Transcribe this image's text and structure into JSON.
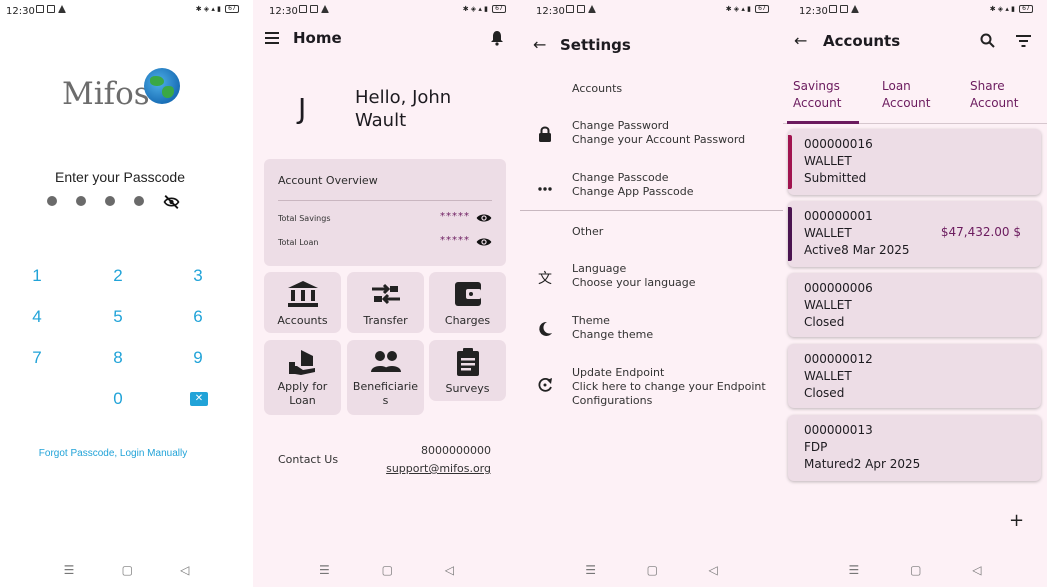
{
  "status": {
    "time": "12:30",
    "battery": "67"
  },
  "passcode_screen": {
    "logo_text": "Mifos",
    "title": "Enter your Passcode",
    "keys": [
      "1",
      "2",
      "3",
      "4",
      "5",
      "6",
      "7",
      "8",
      "9",
      "0"
    ],
    "forgot_link": "Forgot Passcode, Login Manually"
  },
  "home_screen": {
    "title": "Home",
    "avatar_initial": "J",
    "greeting": "Hello, John Wault",
    "overview": {
      "title": "Account Overview",
      "rows": [
        {
          "label": "Total Savings",
          "value": "*****"
        },
        {
          "label": "Total Loan",
          "value": "*****"
        }
      ]
    },
    "tiles": [
      {
        "label": "Accounts",
        "icon": "bank-icon"
      },
      {
        "label": "Transfer",
        "icon": "transfer-icon"
      },
      {
        "label": "Charges",
        "icon": "wallet-icon"
      },
      {
        "label": "Apply for Loan",
        "icon": "hand-coin-icon"
      },
      {
        "label": "Beneficiarie s",
        "icon": "people-icon"
      },
      {
        "label": "Surveys",
        "icon": "clipboard-icon"
      }
    ],
    "contact": {
      "label": "Contact Us",
      "phone": "8000000000",
      "email": "support@mifos.org"
    }
  },
  "settings_screen": {
    "title": "Settings",
    "section_accounts": "Accounts",
    "section_other": "Other",
    "items": [
      {
        "title": "Change Password",
        "subtitle": "Change your Account Password",
        "icon": "lock-icon"
      },
      {
        "title": "Change Passcode",
        "subtitle": "Change App Passcode",
        "icon": "dots-icon"
      },
      {
        "title": "Language",
        "subtitle": "Choose your language",
        "icon": "translate-icon"
      },
      {
        "title": "Theme",
        "subtitle": "Change theme",
        "icon": "moon-icon"
      },
      {
        "title": "Update Endpoint",
        "subtitle": "Click here to change your Endpoint Configurations",
        "icon": "refresh-icon"
      }
    ]
  },
  "accounts_screen": {
    "title": "Accounts",
    "tabs": [
      "Savings Account",
      "Loan Account",
      "Share Account"
    ],
    "cards": [
      {
        "number": "000000016",
        "product": "WALLET",
        "status": "Submitted",
        "balance": "",
        "stripe": "#a0144f"
      },
      {
        "number": "000000001",
        "product": "WALLET",
        "status": "Active8 Mar 2025",
        "balance": "$47,432.00 $",
        "stripe": "#4a1450"
      },
      {
        "number": "000000006",
        "product": "WALLET",
        "status": "Closed",
        "balance": "",
        "stripe": ""
      },
      {
        "number": "000000012",
        "product": "WALLET",
        "status": "Closed",
        "balance": "",
        "stripe": ""
      },
      {
        "number": "000000013",
        "product": "FDP",
        "status": "Matured2 Apr 2025",
        "balance": "",
        "stripe": ""
      }
    ]
  },
  "colors": {
    "accent": "#6b1b5e",
    "passcode_blue": "#21a3d8",
    "card_bg": "#eddde6",
    "screen_bg": "#fdf1f6"
  }
}
